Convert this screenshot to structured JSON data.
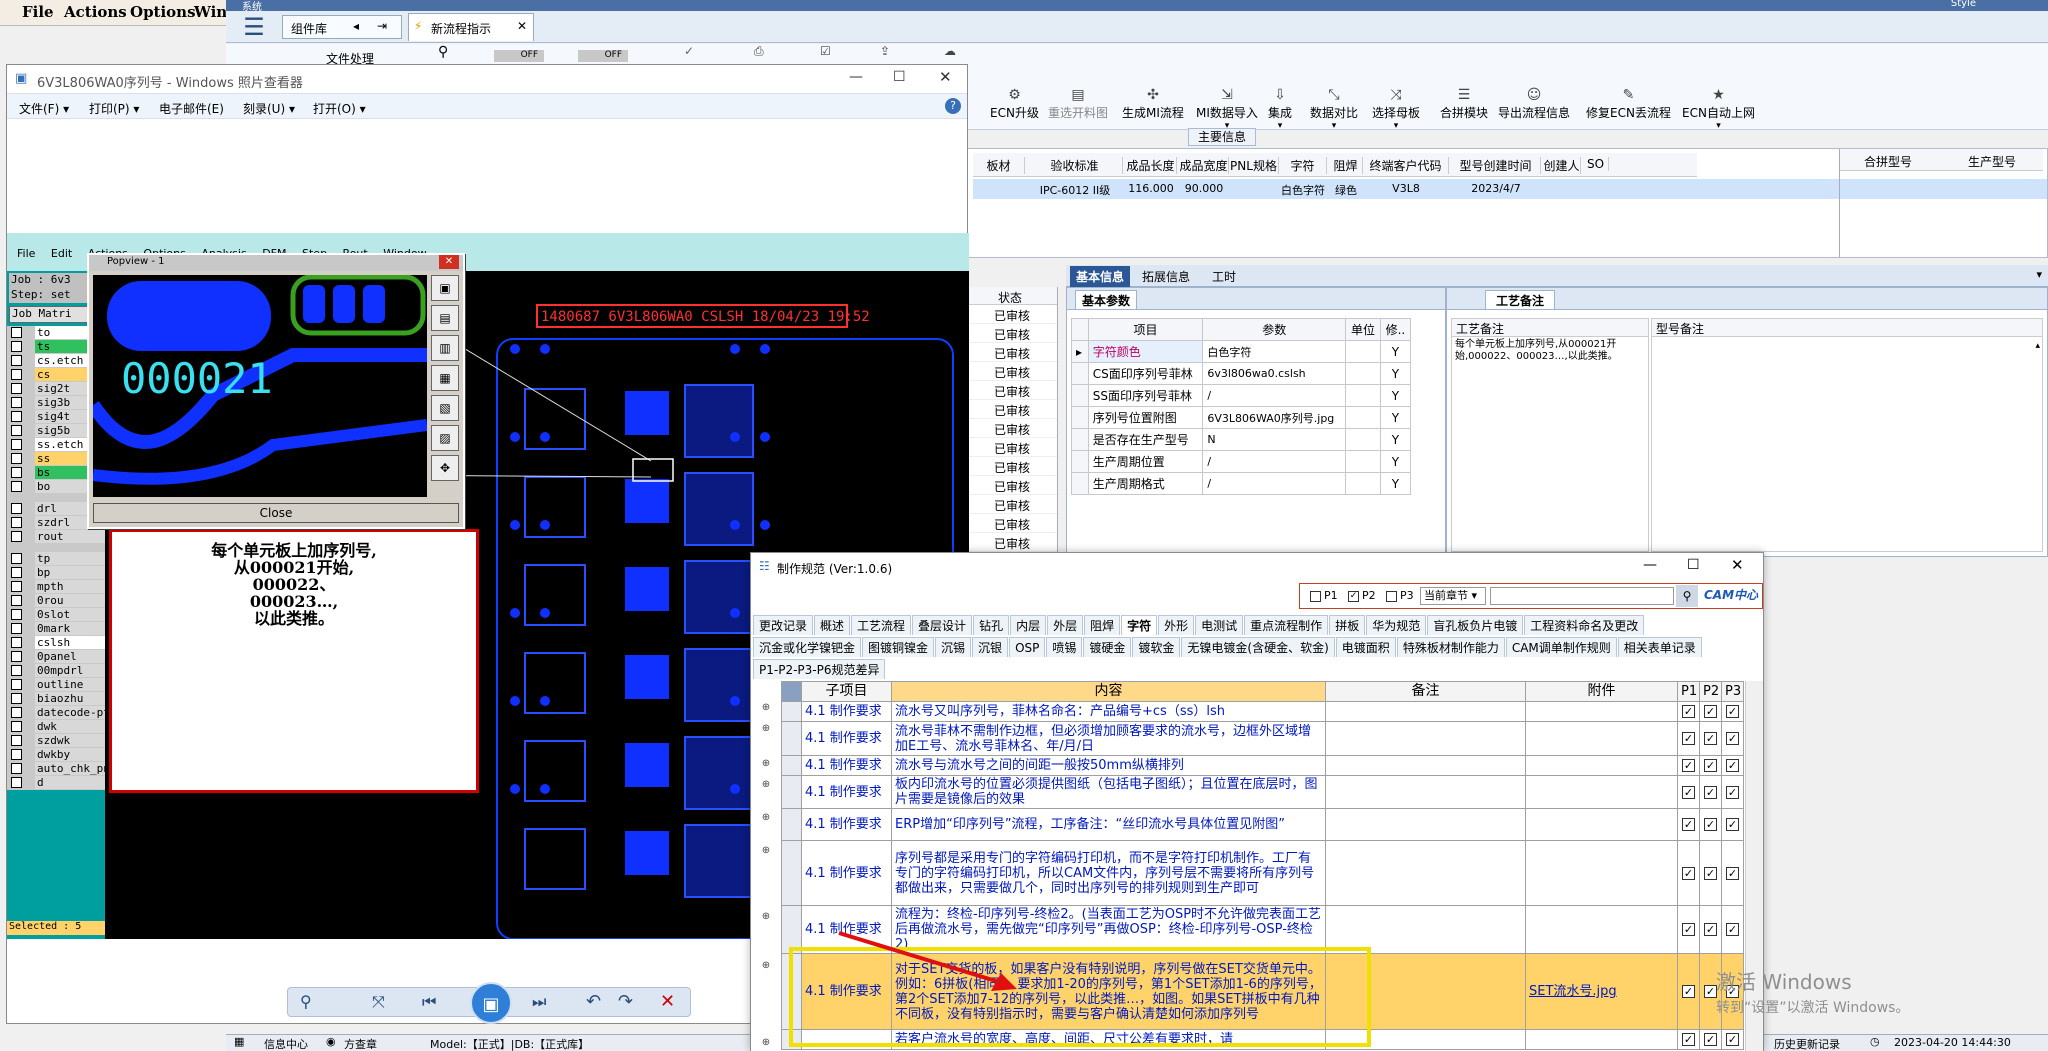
{
  "bg_menu": {
    "items": [
      "File",
      "Actions",
      "Options",
      "Wind"
    ]
  },
  "main_app": {
    "system_label": "系统",
    "hamburger": "☰",
    "component_lib": "组件库",
    "tab_new": "新流程指示",
    "file_proc": "文件处理",
    "style_label": "Style",
    "off1": "OFF",
    "off2": "OFF",
    "ribbon": [
      "ECN升级",
      "重选开料图",
      "生成MI流程",
      "MI数据导入",
      "集成",
      "数据对比",
      "选择母板",
      "合拼模块",
      "导出流程信息",
      "修复ECN丢流程",
      "ECN自动上网"
    ],
    "main_info_title": "主要信息",
    "info_headers": [
      "板材",
      "验收标准",
      "成品长度",
      "成品宽度",
      "PNL规格",
      "字符",
      "阻焊",
      "终端客户代码",
      "型号创建时间",
      "创建人",
      "SO"
    ],
    "info_values": [
      "",
      "IPC-6012 II级",
      "116.000",
      "90.000",
      "",
      "白色字符",
      "绿色",
      "V3L8",
      "2023/4/7",
      "",
      ""
    ],
    "right_headers": [
      "合拼型号",
      "生产型号"
    ],
    "tabs": [
      "基本信息",
      "拓展信息",
      "工时"
    ],
    "basic_params": "基本参数",
    "param_headers": [
      "项目",
      "参数",
      "单位",
      "修.."
    ],
    "params": [
      {
        "item": "字符颜色",
        "value": "白色字符",
        "unit": "",
        "mod": "Y"
      },
      {
        "item": "CS面印序列号菲林",
        "value": "6v3l806wa0.cslsh",
        "unit": "",
        "mod": "Y"
      },
      {
        "item": "SS面印序列号菲林",
        "value": "/",
        "unit": "",
        "mod": "Y"
      },
      {
        "item": "序列号位置附图",
        "value": "6V3L806WA0序列号.jpg",
        "unit": "",
        "mod": "Y"
      },
      {
        "item": "是否存在生产型号",
        "value": "N",
        "unit": "",
        "mod": "Y"
      },
      {
        "item": "生产周期位置",
        "value": "/",
        "unit": "",
        "mod": "Y"
      },
      {
        "item": "生产周期格式",
        "value": "/",
        "unit": "",
        "mod": "Y"
      }
    ],
    "status_header": "状态",
    "status_value": "已审核",
    "process_note_tab": "工艺备注",
    "process_note_label": "工艺备注",
    "model_note_label": "型号备注",
    "process_note_text": "每个单元板上加序列号,从000021开始,000022、000023…,以此类推。",
    "status_bar": {
      "info_center": "信息中心",
      "fang": "方查章",
      "model": "Model:【正式】|DB:【正式库】",
      "history": "历史更新记录",
      "time": "2023-04-20 14:44:30"
    }
  },
  "photo_viewer": {
    "title": "6V3L806WA0序列号 - Windows 照片查看器",
    "menu": [
      "文件(F)",
      "打印(P)",
      "电子邮件(E)",
      "刻录(U)",
      "打开(O)"
    ],
    "cam_menu": [
      "File",
      "Edit",
      "Actions",
      "Options",
      "Analysis",
      "DFM",
      "Step",
      "Rout",
      "Window"
    ],
    "job": "Job : 6v3",
    "step": "Step: set",
    "job_matrix": "Job Matri",
    "layers": [
      "to",
      "ts",
      "cs.etch",
      "cs",
      "sig2t",
      "sig3b",
      "sig4t",
      "sig5b",
      "ss.etch",
      "ss",
      "bs",
      "bo",
      "drl",
      "szdrl",
      "rout",
      "tp",
      "bp",
      "mpth",
      "0rou",
      "0slot",
      "0mark",
      "cslsh",
      "0panel",
      "00mpdrl",
      "outline",
      "biaozhu",
      "datecode-pt",
      "dwk",
      "szdwk",
      "dwkby",
      "auto_chk_pn",
      "d"
    ],
    "selected": "Selected : 5",
    "popview_title": "Popview - 1",
    "popview_number": "000021",
    "popview_close": "Close",
    "board_label": "1480687 6V3L806WA0 CSLSH 18/04/23 19:52",
    "annotation": [
      "每个单元板上加序列号,",
      "从000021开始,",
      "000022、",
      "000023…,",
      "以此类推。"
    ]
  },
  "spec_window": {
    "title": "制作规范 (Ver:1.0.6)",
    "filter": {
      "p1": "P1",
      "p2": "P2",
      "p3": "P3",
      "chapter": "当前章节"
    },
    "logo": "CAM中心",
    "tabs_row1": [
      "更改记录",
      "概述",
      "工艺流程",
      "叠层设计",
      "钻孔",
      "内层",
      "外层",
      "阻焊",
      "字符",
      "外形",
      "电测试",
      "重点流程制作",
      "拼板",
      "华为规范",
      "盲孔板负片电镀",
      "工程资料命名及更改"
    ],
    "tabs_row2": [
      "沉金或化学镍钯金",
      "图镀铜镍金",
      "沉锡",
      "沉银",
      "OSP",
      "喷锡",
      "镀硬金",
      "镀软金",
      "无镍电镀金(含硬金、软金)",
      "电镀面积",
      "特殊板材制作能力",
      "CAM调单制作规则",
      "相关表单记录"
    ],
    "tabs_row3": [
      "P1-P2-P3-P6规范差异"
    ],
    "headers": [
      "子项目",
      "内容",
      "备注",
      "附件",
      "P1",
      "P2",
      "P3"
    ],
    "rows": [
      {
        "sub": "4.1 制作要求",
        "content": "流水号又叫序列号，菲林名命名：产品编号+cs（ss）lsh",
        "attach": ""
      },
      {
        "sub": "4.1 制作要求",
        "content": "流水号菲林不需制作边框，但必须增加顾客要求的流水号，边框外区域增加E工号、流水号菲林名、年/月/日",
        "attach": ""
      },
      {
        "sub": "4.1 制作要求",
        "content": "流水号与流水号之间的间距一般按50mm纵横排列",
        "attach": ""
      },
      {
        "sub": "4.1 制作要求",
        "content": "板内印流水号的位置必须提供图纸（包括电子图纸）；且位置在底层时，图片需要是镜像后的效果",
        "attach": ""
      },
      {
        "sub": "4.1 制作要求",
        "content": "ERP增加“印序列号”流程，工序备注：“丝印流水号具体位置见附图”",
        "attach": ""
      },
      {
        "sub": "4.1 制作要求",
        "content": "序列号都是采用专门的字符编码打印机，而不是字符打印机制作。工厂有专门的字符编码打印机，所以CAM文件内，序列号层不需要将所有序列号都做出来，只需要做几个，同时出序列号的排列规则到生产即可",
        "attach": ""
      },
      {
        "sub": "4.1 制作要求",
        "content": "流程为：终检-印序列号-终检2。(当表面工艺为OSP时不允许做完表面工艺后再做流水号，需先做完“印序列号”再做OSP：终检-印序列号-OSP-终检2)",
        "attach": ""
      },
      {
        "sub": "4.1 制作要求",
        "content": "对于SET交货的板，如果客户没有特别说明，序列号做在SET交货单元中。 例如：6拼板(相同)，要求加1-20的序列号，第1个SET添加1-6的序列号，第2个SET添加7-12的序列号，以此类推…，如图。如果SET拼板中有几种不同板，没有特别指示时，需要与客户确认清楚如何添加序列号",
        "attach": "SET流水号.jpg"
      },
      {
        "sub": "",
        "content": "若客户流水号的宽度、高度、间距、尺寸公差有要求时，请",
        "attach": ""
      }
    ],
    "row_tops": [
      704,
      725,
      759,
      779,
      811,
      843,
      908,
      956,
      1032
    ]
  },
  "viewer_controls": [
    "⚲",
    "⤧",
    "⏮",
    "▣",
    "⏭",
    "↶",
    "↷",
    "✕"
  ],
  "watermark": {
    "line1": "激活 Windows",
    "line2": "转到“设置”以激活 Windows。"
  },
  "colors": {
    "cam_bg": "#000000",
    "teal": "#009f9f",
    "blue_fill": "#1030ff",
    "highlight": "#ffd36a",
    "annotation_border": "#d00000"
  }
}
